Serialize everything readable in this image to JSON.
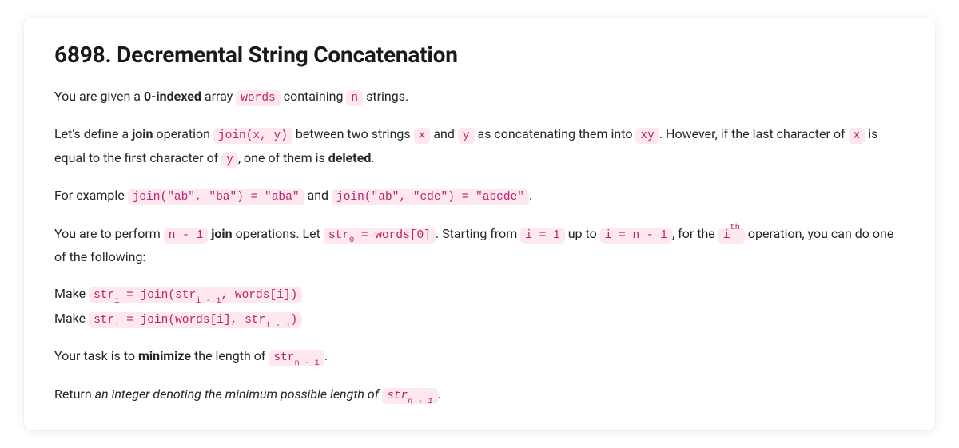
{
  "title": "6898. Decremental String Concatenation",
  "p1": {
    "t1": "You are given a ",
    "b1": "0-indexed",
    "t2": " array ",
    "c1": "words",
    "t3": " containing ",
    "c2": "n",
    "t4": " strings."
  },
  "p2": {
    "t1": "Let's define a ",
    "b1": "join",
    "t2": " operation ",
    "c1": "join(x, y)",
    "t3": " between two strings ",
    "c2": "x",
    "t4": " and ",
    "c3": "y",
    "t5": " as concatenating them into ",
    "c4": "xy",
    "t6": ". However, if the last character of ",
    "c5": "x",
    "t7": " is equal to the first character of ",
    "c6": "y",
    "t8": ", one of them is ",
    "b2": "deleted",
    "t9": "."
  },
  "p3": {
    "t1": "For example ",
    "c1": "join(\"ab\", \"ba\") = \"aba\"",
    "t2": " and ",
    "c2": "join(\"ab\", \"cde\") = \"abcde\"",
    "t3": "."
  },
  "p4": {
    "t1": "You are to perform ",
    "c1": "n - 1",
    "t2": " ",
    "b1": "join",
    "t3": " operations. Let ",
    "c2a": "str",
    "c2sub": "0",
    "c2b": " = words[0]",
    "t4": ". Starting from ",
    "c3": "i = 1",
    "t5": " up to ",
    "c4": "i = n - 1",
    "t6": ", for the ",
    "c5a": "i",
    "c5sup": "th",
    "t7": " operation, you can do one of the following:"
  },
  "p5a": {
    "t1": "Make ",
    "c1a": "str",
    "c1sub": "i",
    "c1b": " = join(str",
    "c1sub2": "i - 1",
    "c1c": ", words[i])"
  },
  "p5b": {
    "t1": "Make ",
    "c1a": "str",
    "c1sub": "i",
    "c1b": " = join(words[i], str",
    "c1sub2": "i - 1",
    "c1c": ")"
  },
  "p6": {
    "t1": "Your task is to ",
    "b1": "minimize",
    "t2": " the length of ",
    "c1a": "str",
    "c1sub": "n - 1",
    "t3": "."
  },
  "p7": {
    "t1": "Return ",
    "i1": "an integer denoting the minimum possible length of ",
    "c1a": "str",
    "c1sub": "n - 1",
    "t2": "."
  }
}
